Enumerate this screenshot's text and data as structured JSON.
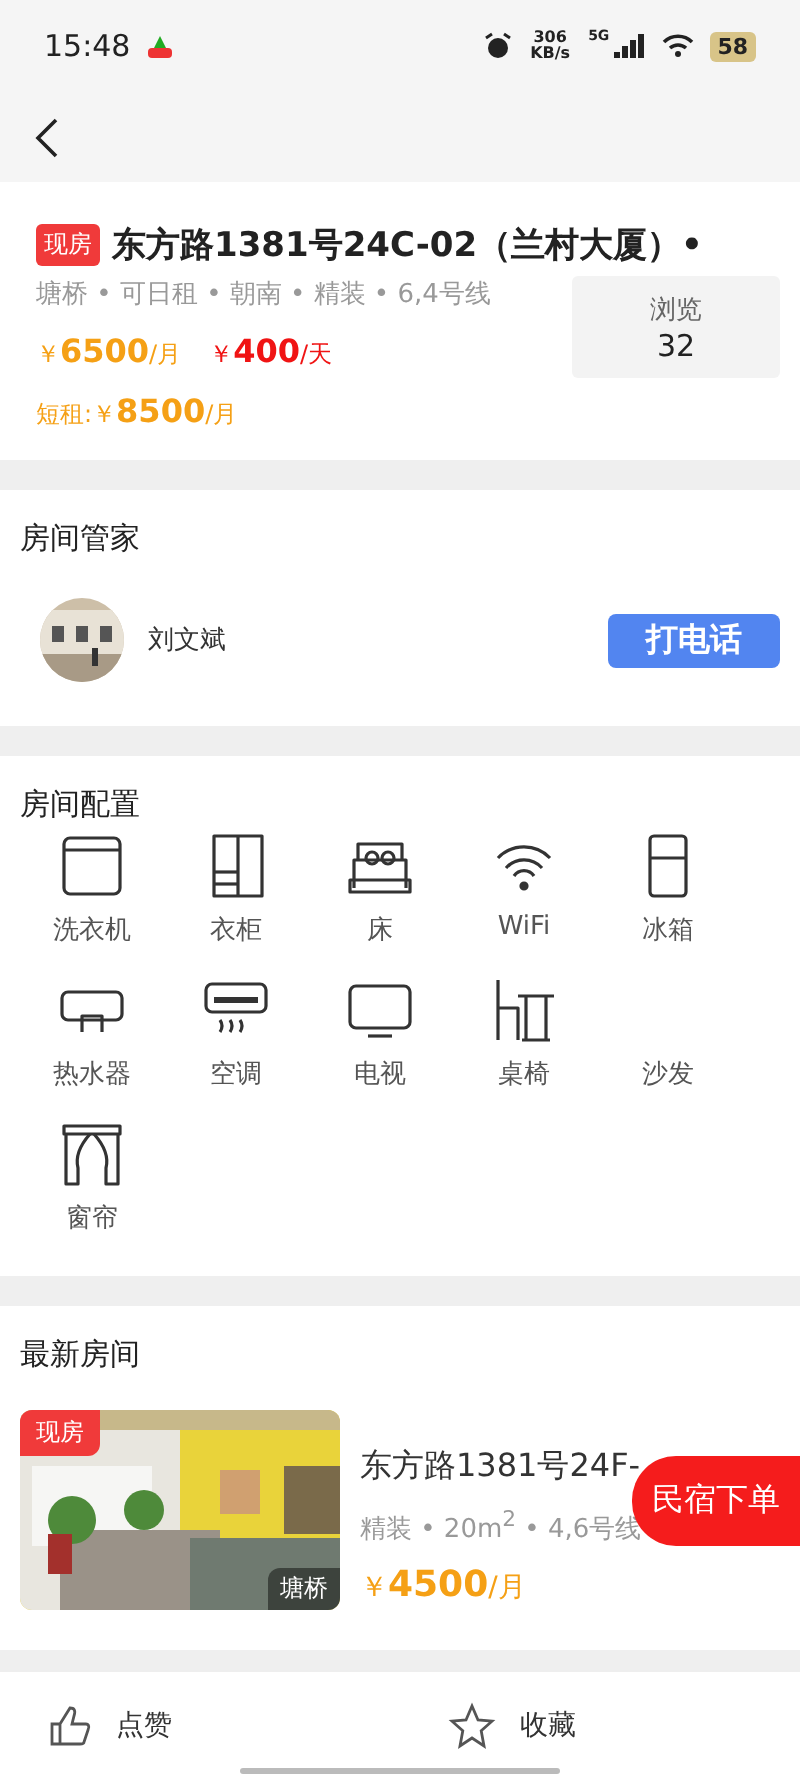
{
  "status_bar": {
    "time": "15:48",
    "net_speed": "306 KB/s",
    "network": "5G",
    "battery": "58"
  },
  "listing": {
    "badge": "现房",
    "title": "东方路1381号24C-02（兰村大厦）•",
    "tags": "塘桥 • 可日租 • 朝南 • 精装 • 6,4号线",
    "price_month": {
      "symbol": "￥",
      "amount": "6500",
      "unit": "/月"
    },
    "price_day": {
      "symbol": "￥",
      "amount": "400",
      "unit": "/天"
    },
    "short_rent": {
      "label": "短租:",
      "symbol": "￥",
      "amount": "8500",
      "unit": "/月"
    },
    "views": {
      "label": "浏览",
      "count": "32"
    }
  },
  "manager": {
    "heading": "房间管家",
    "name": "刘文斌",
    "call_button": "打电话"
  },
  "amenities": {
    "heading": "房间配置",
    "items": [
      {
        "label": "洗衣机",
        "kind": "washer"
      },
      {
        "label": "衣柜",
        "kind": "wardrobe"
      },
      {
        "label": "床",
        "kind": "bed"
      },
      {
        "label": "WiFi",
        "kind": "wifi"
      },
      {
        "label": "冰箱",
        "kind": "fridge"
      },
      {
        "label": "热水器",
        "kind": "heater"
      },
      {
        "label": "空调",
        "kind": "aircon"
      },
      {
        "label": "电视",
        "kind": "tv"
      },
      {
        "label": "桌椅",
        "kind": "desk"
      },
      {
        "label": "沙发",
        "kind": "none"
      },
      {
        "label": "窗帘",
        "kind": "curtain"
      }
    ]
  },
  "latest": {
    "heading": "最新房间",
    "rooms": [
      {
        "badge": "现房",
        "area": "塘桥",
        "title": "东方路1381号24F-",
        "details": "精装 • 20m$^{2}$ • 4,6号线",
        "price": {
          "symbol": "￥",
          "amount": "4500",
          "unit": "/月"
        }
      }
    ]
  },
  "float_button": "民宿下单",
  "bottom_bar": [
    {
      "label": "点赞",
      "kind": "like"
    },
    {
      "label": "收藏",
      "kind": "favorite"
    }
  ]
}
